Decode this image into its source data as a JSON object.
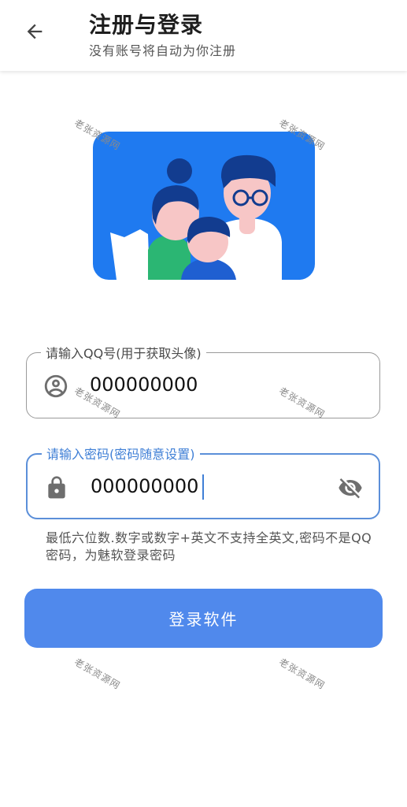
{
  "header": {
    "title": "注册与登录",
    "subtitle": "没有账号将自动为你注册"
  },
  "illustration": {
    "background_color": "#1f7af0"
  },
  "watermark": {
    "text": "老张资源网"
  },
  "qq_field": {
    "label": "请输入QQ号(用于获取头像)",
    "value": "000000000",
    "icon": "account-circle-icon"
  },
  "password_field": {
    "label": "请输入密码(密码随意设置)",
    "value": "000000000",
    "icon": "lock-icon",
    "toggle_icon": "eye-off-icon",
    "focused": true
  },
  "hint": {
    "text": "最低六位数.数字或数字+英文不支持全英文,密码不是QQ密码，为魅软登录密码"
  },
  "actions": {
    "login_label": "登录软件"
  },
  "colors": {
    "accent": "#5089ec",
    "focus_border": "#5b8fd9",
    "focus_label": "#3f7fd6"
  }
}
